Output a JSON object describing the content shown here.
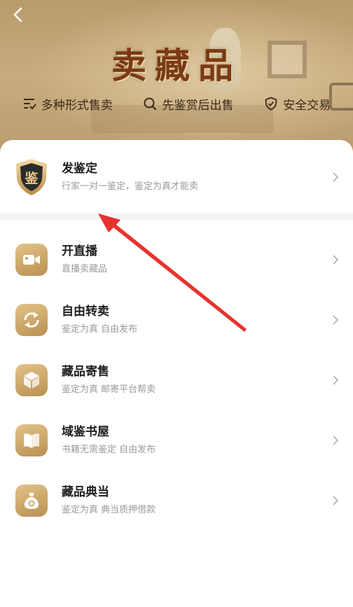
{
  "header": {
    "back_label": "<",
    "title": "卖藏品",
    "features": [
      {
        "icon": "list-check-icon",
        "label": "多种形式售卖"
      },
      {
        "icon": "search-icon",
        "label": "先鉴赏后出售"
      },
      {
        "icon": "shield-check-icon",
        "label": "安全交易"
      }
    ]
  },
  "featured": {
    "badge_text": "鉴",
    "title": "发鉴定",
    "subtitle": "行家一对一鉴定，鉴定为真才能卖"
  },
  "items": [
    {
      "icon": "video-camera-icon",
      "title": "开直播",
      "subtitle": "直播卖藏品"
    },
    {
      "icon": "refresh-arrows-icon",
      "title": "自由转卖",
      "subtitle": "鉴定为真 自由发布"
    },
    {
      "icon": "package-box-icon",
      "title": "藏品寄售",
      "subtitle": "鉴定为真 邮寄平台帮卖"
    },
    {
      "icon": "book-icon",
      "title": "域鉴书屋",
      "subtitle": "书籍无需鉴定 自由发布"
    },
    {
      "icon": "money-bag-icon",
      "title": "藏品典当",
      "subtitle": "鉴定为真 典当质押借款"
    }
  ],
  "colors": {
    "accent_gold": "#c9a266",
    "title_brown": "#7a3a15",
    "annotation_red": "#e8322f"
  }
}
